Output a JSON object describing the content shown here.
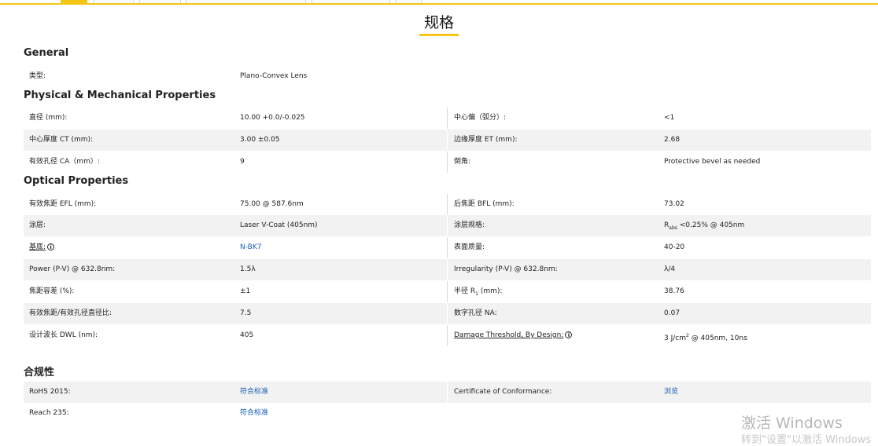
{
  "page_title": "规格",
  "sections": {
    "general": {
      "title": "General",
      "rows": [
        {
          "label": "类型:",
          "value": "Plano-Convex Lens"
        }
      ]
    },
    "physical": {
      "title": "Physical & Mechanical Properties",
      "rows": [
        {
          "l1": "直径 (mm):",
          "v1": "10.00 +0.0/-0.025",
          "l2": "中心偏（弧分）:",
          "v2": "<1"
        },
        {
          "l1": "中心厚度 CT (mm):",
          "v1": "3.00 ±0.05",
          "l2": "边缘厚度 ET (mm):",
          "v2": "2.68"
        },
        {
          "l1": "有效孔径 CA（mm）:",
          "v1": "9",
          "l2": "倒角:",
          "v2": "Protective bevel as needed"
        }
      ]
    },
    "optical": {
      "title": "Optical Properties",
      "rows": [
        {
          "l1": "有效焦距 EFL (mm):",
          "v1": "75.00 @ 587.6nm",
          "l2": "后焦距 BFL (mm):",
          "v2": "73.02"
        },
        {
          "l1": "涂层:",
          "v1": "Laser V-Coat (405nm)",
          "l2": "涂层规格:",
          "v2_r": "R",
          "v2_sub": "abs",
          "v2_rest": " <0.25% @ 405nm"
        },
        {
          "l1": "基底:",
          "v1": "N-BK7",
          "l2": "表面质量:",
          "v2": "40-20"
        },
        {
          "l1": "Power (P-V) @ 632.8nm:",
          "v1": "1.5λ",
          "l2": "Irregularity (P-V) @ 632.8nm:",
          "v2": "λ/4"
        },
        {
          "l1": "焦距容差 (%):",
          "v1": "±1",
          "l2_a": "半径 R",
          "l2_sub": "1",
          "l2_b": " (mm):",
          "v2": "38.76"
        },
        {
          "l1": "有效焦距/有效孔径直径比:",
          "v1": "7.5",
          "l2": "数字孔径 NA:",
          "v2": "0.07"
        },
        {
          "l1": "设计波长 DWL (nm):",
          "v1": "405",
          "l2": "Damage Threshold, By Design:",
          "v2_a": "3 J/cm",
          "v2_sup": "2",
          "v2_b": " @ 405nm, 10ns"
        }
      ]
    },
    "compliance": {
      "title": "合规性",
      "rows": [
        {
          "l1": "RoHS 2015:",
          "v1": "符合标准",
          "l2": "Certificate of Conformance:",
          "v2": "浏览"
        },
        {
          "l1": "Reach 235:",
          "v1": "符合标准"
        }
      ]
    }
  },
  "info_icon_glyph": "i",
  "watermark": {
    "line1": "激活 Windows",
    "line2": "转到\"设置\"以激活 Windows"
  },
  "colors": {
    "accent": "#f5c518",
    "link": "#1a5fb4",
    "row_shade": "#f2f2f2"
  }
}
